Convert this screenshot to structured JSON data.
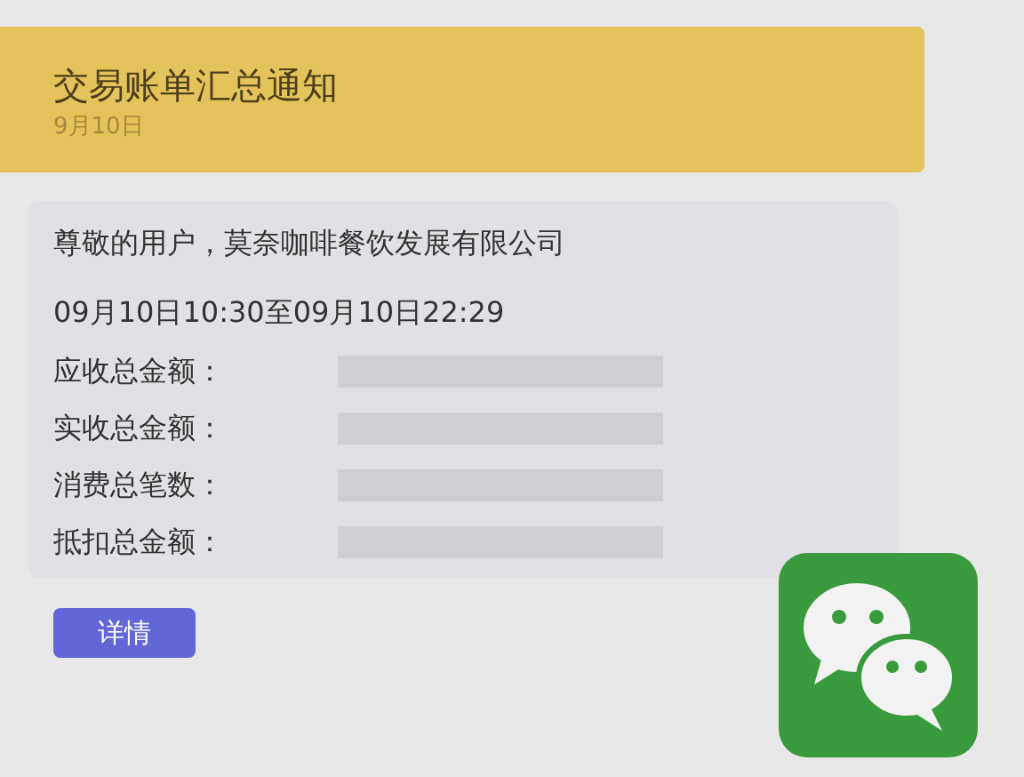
{
  "header": {
    "title": "交易账单汇总通知",
    "date": "9月10日"
  },
  "body": {
    "greeting": "尊敬的用户，莫奈咖啡餐饮发展有限公司",
    "period": "09月10日10:30至09月10日22:29",
    "fields": [
      {
        "label": "应收总金额："
      },
      {
        "label": "实收总金额："
      },
      {
        "label": "消费总笔数："
      },
      {
        "label": "抵扣总金额："
      }
    ]
  },
  "button": "详情"
}
